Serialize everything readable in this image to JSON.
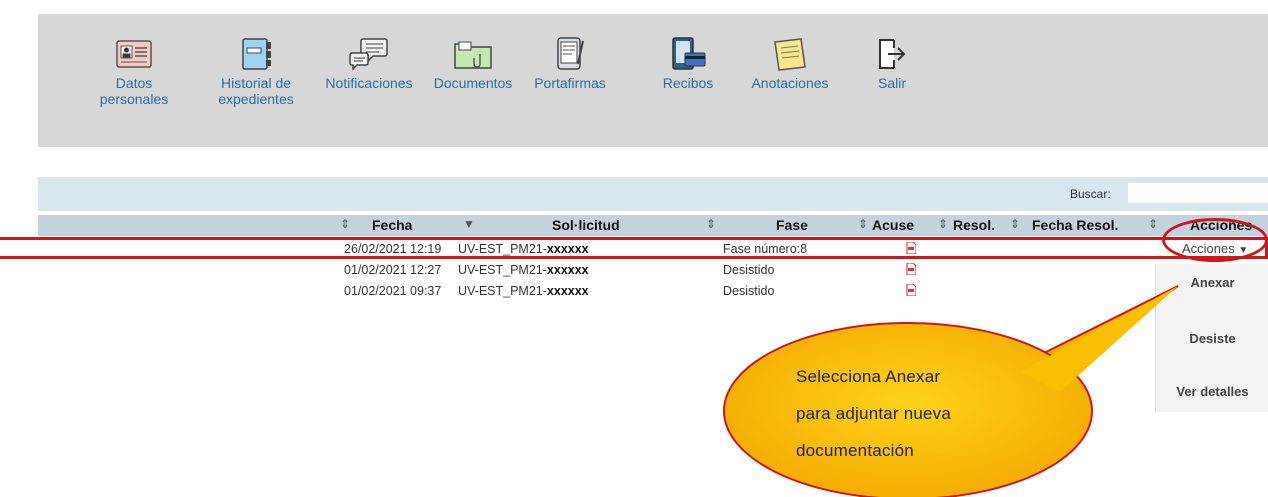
{
  "toolbar": {
    "items": [
      {
        "label_lines": [
          "Datos",
          "personales"
        ],
        "icon": "id-card-icon"
      },
      {
        "label_lines": [
          "Historial de",
          "expedientes"
        ],
        "icon": "notebook-icon"
      },
      {
        "label_lines": [
          "Notificaciones"
        ],
        "icon": "speech-bubbles-icon"
      },
      {
        "label_lines": [
          "Documentos"
        ],
        "icon": "folder-icon"
      },
      {
        "label_lines": [
          "Portafirmas"
        ],
        "icon": "tablet-pen-icon"
      },
      {
        "label_lines": [
          "Recibos"
        ],
        "icon": "tablet-card-icon"
      },
      {
        "label_lines": [
          "Anotaciones"
        ],
        "icon": "sticky-note-icon"
      },
      {
        "label_lines": [
          "Salir"
        ],
        "icon": "exit-icon"
      }
    ]
  },
  "search": {
    "label": "Buscar:",
    "value": ""
  },
  "table": {
    "headers": {
      "fecha": "Fecha",
      "solicitud": "Sol·licitud",
      "fase": "Fase",
      "acuse": "Acuse",
      "resol": "Resol.",
      "fecha_resol": "Fecha Resol.",
      "acciones": "Acciones"
    },
    "rows": [
      {
        "fecha": "26/02/2021 12:19",
        "solicitud_prefix": "UV-EST_PM21-",
        "solicitud_suffix": "xxxxxx",
        "fase": "Fase número:8"
      },
      {
        "fecha": "01/02/2021 12:27",
        "solicitud_prefix": "UV-EST_PM21-",
        "solicitud_suffix": "xxxxxx",
        "fase": "Desistido"
      },
      {
        "fecha": "01/02/2021 09:37",
        "solicitud_prefix": "UV-EST_PM21-",
        "solicitud_suffix": "xxxxxx",
        "fase": "Desistido"
      }
    ]
  },
  "actions": {
    "button_label": "Acciones",
    "menu": [
      "Anexar",
      "Desiste",
      "Ver detalles"
    ]
  },
  "callout": {
    "lines": [
      "Selecciona Anexar",
      "para adjuntar nueva",
      "documentación"
    ]
  },
  "colors": {
    "toolbar_bg": "#d7d7d7",
    "link_blue": "#2d6e9e",
    "highlight_red": "#d0161c",
    "callout_fill": "#fbbd00"
  }
}
